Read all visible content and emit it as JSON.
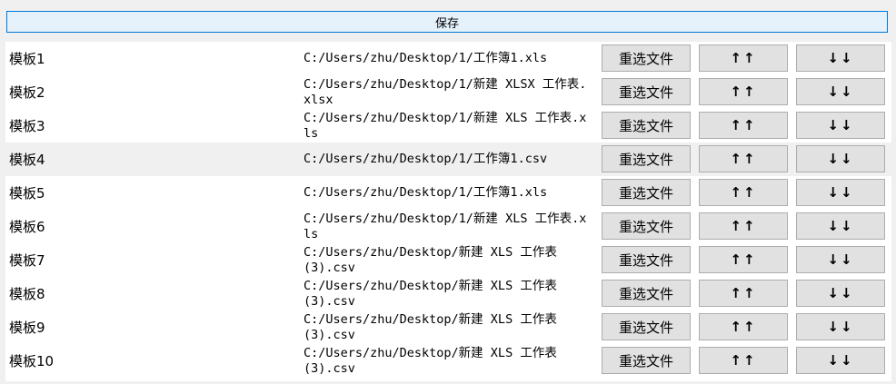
{
  "toolbar": {
    "save_label": "保存"
  },
  "buttons": {
    "reselect_label": "重选文件",
    "up_label": "↑↑",
    "down_label": "↓↓"
  },
  "templates": [
    {
      "name": "模板1",
      "path": "C:/Users/zhu/Desktop/1/工作簿1.xls"
    },
    {
      "name": "模板2",
      "path": "C:/Users/zhu/Desktop/1/新建 XLSX 工作表.xlsx"
    },
    {
      "name": "模板3",
      "path": "C:/Users/zhu/Desktop/1/新建 XLS 工作表.xls"
    },
    {
      "name": "模板4",
      "path": "C:/Users/zhu/Desktop/1/工作簿1.csv"
    },
    {
      "name": "模板5",
      "path": "C:/Users/zhu/Desktop/1/工作簿1.xls"
    },
    {
      "name": "模板6",
      "path": "C:/Users/zhu/Desktop/1/新建 XLS 工作表.xls"
    },
    {
      "name": "模板7",
      "path": "C:/Users/zhu/Desktop/新建 XLS 工作表 (3).csv"
    },
    {
      "name": "模板8",
      "path": "C:/Users/zhu/Desktop/新建 XLS 工作表 (3).csv"
    },
    {
      "name": "模板9",
      "path": "C:/Users/zhu/Desktop/新建 XLS 工作表 (3).csv"
    },
    {
      "name": "模板10",
      "path": "C:/Users/zhu/Desktop/新建 XLS 工作表 (3).csv"
    }
  ],
  "highlighted_row_index": 3
}
